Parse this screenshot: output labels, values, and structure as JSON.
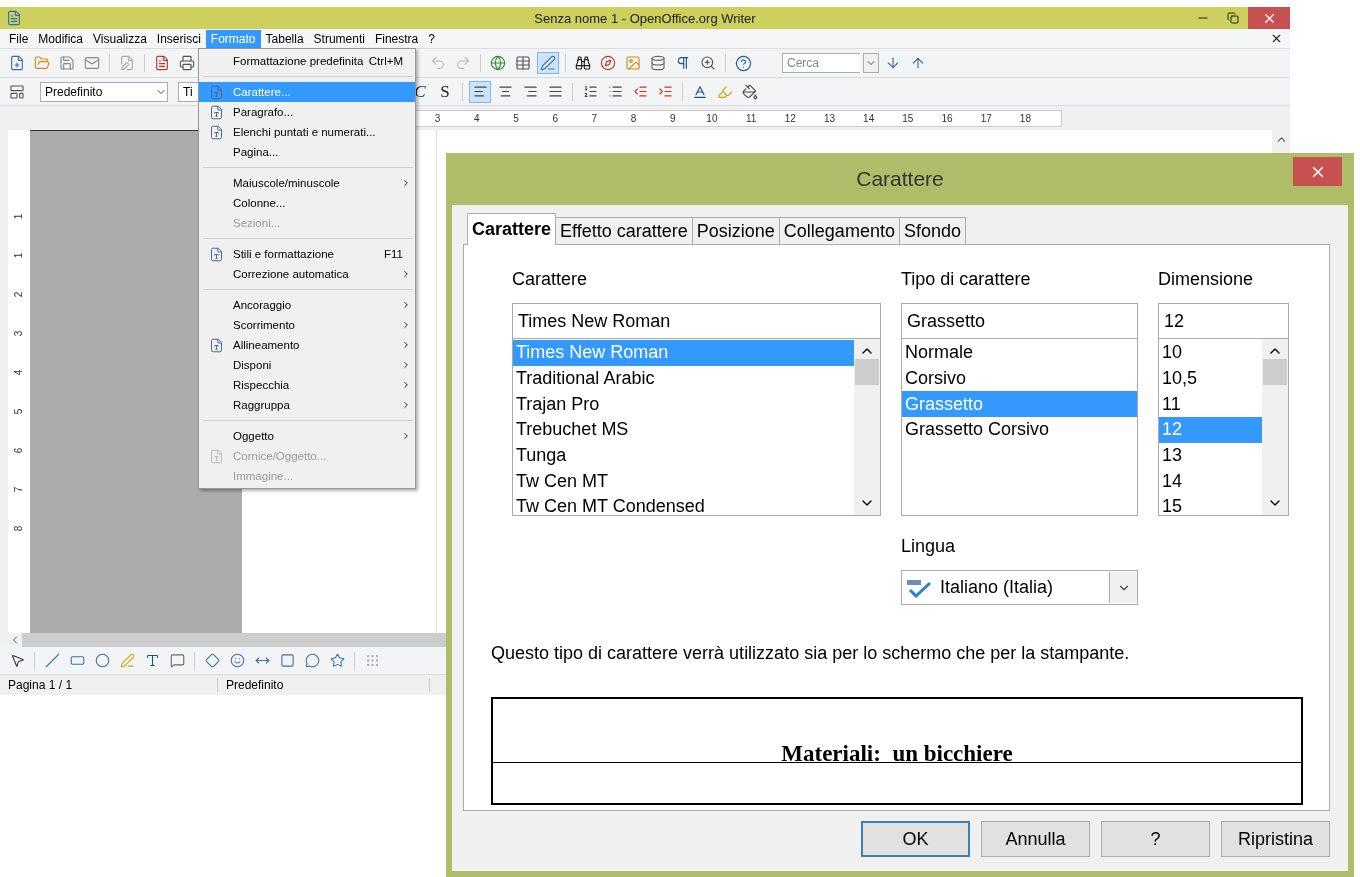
{
  "writer": {
    "title": "Senza nome 1 - OpenOffice.org Writer",
    "menu_bar": [
      {
        "label": "File",
        "selected": false
      },
      {
        "label": "Modifica",
        "selected": false
      },
      {
        "label": "Visualizza",
        "selected": false
      },
      {
        "label": "Inserisci",
        "selected": false
      },
      {
        "label": "Formato",
        "selected": true
      },
      {
        "label": "Tabella",
        "selected": false
      },
      {
        "label": "Strumenti",
        "selected": false
      },
      {
        "label": "Finestra",
        "selected": false
      },
      {
        "label": "?",
        "selected": false
      }
    ],
    "toolbar": {
      "draw_functions": {
        "selected": true
      },
      "search": {
        "placeholder": "Cerca"
      }
    },
    "format_bar": {
      "style": "Predefinito",
      "font": "Ti",
      "keys": [
        "C",
        "S"
      ],
      "alignment": [
        {
          "selected": true
        },
        {
          "selected": false
        },
        {
          "selected": false
        },
        {
          "selected": false
        }
      ]
    },
    "ruler": [
      "3",
      "4",
      "5",
      "6",
      "7",
      "8",
      "9",
      "10",
      "11",
      "12",
      "13",
      "14",
      "15",
      "16",
      "17",
      "18"
    ],
    "vertical_ruler": [
      "1",
      "1",
      "2",
      "3",
      "4",
      "5",
      "6",
      "7",
      "8"
    ],
    "status_bar": [
      "Pagina 1 / 1",
      "Predefinito"
    ]
  },
  "format_menu": {
    "groups": [
      [
        {
          "label": "Formattazione predefinita",
          "shortcut": "Ctrl+M",
          "icon": false,
          "submenu": false,
          "disabled": false,
          "selected": false
        }
      ],
      [
        {
          "label": "Carattere...",
          "icon": true,
          "submenu": false,
          "disabled": false,
          "selected": true
        },
        {
          "label": "Paragrafo...",
          "icon": true,
          "submenu": false,
          "disabled": false,
          "selected": false
        },
        {
          "label": "Elenchi puntati e numerati...",
          "icon": true,
          "submenu": false,
          "disabled": false,
          "selected": false
        },
        {
          "label": "Pagina...",
          "icon": false,
          "submenu": false,
          "disabled": false,
          "selected": false
        }
      ],
      [
        {
          "label": "Maiuscole/minuscole",
          "icon": false,
          "submenu": true,
          "disabled": false,
          "selected": false
        },
        {
          "label": "Colonne...",
          "icon": false,
          "submenu": false,
          "disabled": false,
          "selected": false
        },
        {
          "label": "Sezioni...",
          "icon": false,
          "submenu": false,
          "disabled": true,
          "selected": false
        }
      ],
      [
        {
          "label": "Stili e formattazione",
          "shortcut": "F11",
          "icon": true,
          "submenu": false,
          "disabled": false,
          "selected": false
        },
        {
          "label": "Correzione automatica",
          "icon": false,
          "submenu": true,
          "disabled": false,
          "selected": false
        }
      ],
      [
        {
          "label": "Ancoraggio",
          "icon": false,
          "submenu": true,
          "disabled": false,
          "selected": false
        },
        {
          "label": "Scorrimento",
          "icon": false,
          "submenu": true,
          "disabled": false,
          "selected": false
        },
        {
          "label": "Allineamento",
          "icon": true,
          "submenu": true,
          "disabled": false,
          "selected": false
        },
        {
          "label": "Disponi",
          "icon": false,
          "submenu": true,
          "disabled": false,
          "selected": false
        },
        {
          "label": "Rispecchia",
          "icon": false,
          "submenu": true,
          "disabled": false,
          "selected": false
        },
        {
          "label": "Raggruppa",
          "icon": false,
          "submenu": true,
          "disabled": false,
          "selected": false
        }
      ],
      [
        {
          "label": "Oggetto",
          "icon": false,
          "submenu": true,
          "disabled": false,
          "selected": false
        },
        {
          "label": "Cornice/Oggetto...",
          "icon": true,
          "submenu": false,
          "disabled": true,
          "selected": false
        },
        {
          "label": "Immagine...",
          "icon": false,
          "submenu": false,
          "disabled": true,
          "selected": false
        }
      ]
    ]
  },
  "dialog": {
    "title": "Carattere",
    "tabs": [
      {
        "label": "Carattere",
        "selected": true
      },
      {
        "label": "Effetto carattere",
        "selected": false
      },
      {
        "label": "Posizione",
        "selected": false
      },
      {
        "label": "Collegamento",
        "selected": false
      },
      {
        "label": "Sfondo",
        "selected": false
      }
    ],
    "columns": [
      {
        "label": "Carattere",
        "value": "Times New Roman",
        "scrollbar": true,
        "items": [
          {
            "label": "Times New Roman",
            "selected": true
          },
          {
            "label": "Traditional Arabic",
            "selected": false
          },
          {
            "label": "Trajan Pro",
            "selected": false
          },
          {
            "label": "Trebuchet MS",
            "selected": false
          },
          {
            "label": "Tunga",
            "selected": false
          },
          {
            "label": "Tw Cen MT",
            "selected": false
          },
          {
            "label": "Tw Cen MT Condensed",
            "selected": false
          }
        ]
      },
      {
        "label": "Tipo di carattere",
        "value": "Grassetto",
        "scrollbar": false,
        "items": [
          {
            "label": "Normale",
            "selected": false
          },
          {
            "label": "Corsivo",
            "selected": false
          },
          {
            "label": "Grassetto",
            "selected": true
          },
          {
            "label": "Grassetto Corsivo",
            "selected": false
          }
        ]
      },
      {
        "label": "Dimensione",
        "value": "12",
        "scrollbar": true,
        "items": [
          {
            "label": "10",
            "selected": false
          },
          {
            "label": "10,5",
            "selected": false
          },
          {
            "label": "11",
            "selected": false
          },
          {
            "label": "12",
            "selected": true
          },
          {
            "label": "13",
            "selected": false
          },
          {
            "label": "14",
            "selected": false
          },
          {
            "label": "15",
            "selected": false
          }
        ]
      }
    ],
    "language": {
      "label": "Lingua",
      "value": "Italiano (Italia)"
    },
    "note": "Questo tipo di carattere verrà utilizzato sia per lo schermo che per la stampante.",
    "preview": "Materiali:  un bicchiere",
    "buttons": [
      {
        "label": "OK",
        "default": true
      },
      {
        "label": "Annulla",
        "default": false
      },
      {
        "label": "?",
        "default": false
      },
      {
        "label": "Ripristina",
        "default": false
      }
    ]
  }
}
